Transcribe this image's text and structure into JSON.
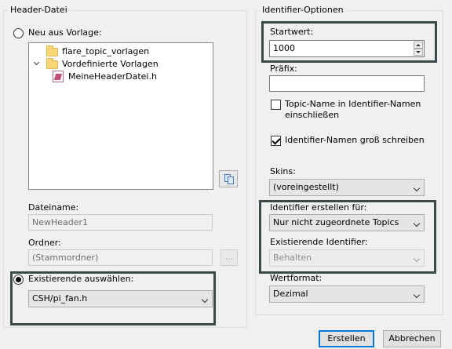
{
  "left_group": {
    "title": "Header-Datei",
    "new_from_template_label": "Neu aus Vorlage:",
    "tree_items": [
      {
        "label": "flare_topic_vorlagen",
        "icon": "folder-icon"
      },
      {
        "label": "Vordefinierte Vorlagen",
        "icon": "folder-open-icon"
      },
      {
        "label": "MeineHeaderDatei.h",
        "icon": "header-file-icon"
      }
    ],
    "filename_label": "Dateiname:",
    "filename_value": "NewHeader1",
    "folder_label": "Ordner:",
    "folder_value": "(Stammordner)",
    "browse_button_label": "...",
    "existing_label": "Existierende auswählen:",
    "existing_value": "CSH/pi_fan.h"
  },
  "right_group": {
    "title": "Identifier-Optionen",
    "start_value_label": "Startwert:",
    "start_value": "1000",
    "prefix_label": "Präfix:",
    "prefix_value": "",
    "topic_name_checkbox_label_line1": "Topic-Name in Identifier-Namen",
    "topic_name_checkbox_label_line2": "einschließen",
    "topic_name_checked": false,
    "uppercase_checkbox_label": "Identifier-Namen groß schreiben",
    "uppercase_checked": true,
    "skins_label": "Skins:",
    "skins_value": "(voreingestellt)",
    "create_for_label": "Identifier erstellen für:",
    "create_for_value": "Nur nicht zugeordnete Topics",
    "existing_ids_label": "Existierende Identifier:",
    "existing_ids_value": "Behalten",
    "value_format_label": "Wertformat:",
    "value_format_value": "Dezimal"
  },
  "buttons": {
    "create_label": "Erstellen",
    "cancel_label": "Abbrechen"
  }
}
